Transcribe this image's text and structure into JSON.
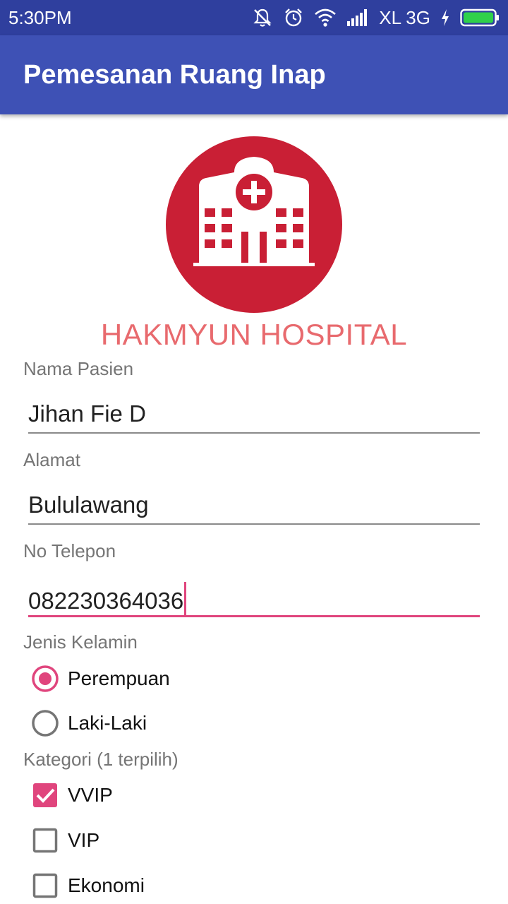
{
  "status_bar": {
    "time": "5:30PM",
    "carrier": "XL 3G",
    "icons": [
      "muted-bell-icon",
      "alarm-clock-icon",
      "wifi-icon",
      "signal-icon",
      "charging-icon",
      "battery-icon"
    ]
  },
  "app_bar": {
    "title": "Pemesanan Ruang Inap"
  },
  "logo": {
    "icon": "hospital-building-icon",
    "color": "#c91f35"
  },
  "hospital_name": "HAKMYUN HOSPITAL",
  "form": {
    "name_label": "Nama Pasien",
    "name_value": "Jihan Fie D",
    "address_label": "Alamat",
    "address_value": "Bululawang",
    "phone_label": "No Telepon",
    "phone_value": "082230364036",
    "gender_label": "Jenis Kelamin",
    "gender_options": [
      {
        "label": "Perempuan",
        "selected": true
      },
      {
        "label": "Laki-Laki",
        "selected": false
      }
    ],
    "category_label": "Kategori (1 terpilih)",
    "category_options": [
      {
        "label": "VVIP",
        "checked": true
      },
      {
        "label": "VIP",
        "checked": false
      },
      {
        "label": "Ekonomi",
        "checked": false
      }
    ]
  },
  "colors": {
    "status_bar": "#2f3f9e",
    "app_bar": "#3e51b5",
    "accent": "#e0457d",
    "hospital_name": "#e86a6e"
  }
}
